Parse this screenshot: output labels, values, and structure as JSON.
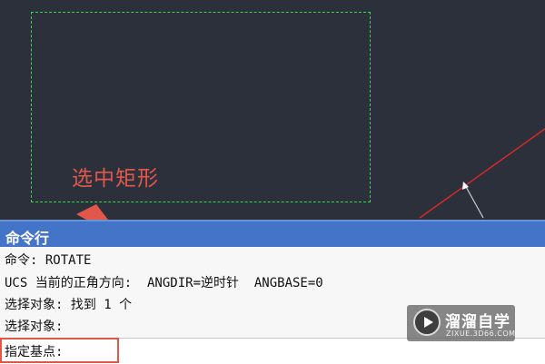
{
  "canvas": {
    "annotation": "选中矩形",
    "colors": {
      "background": "#2c303b",
      "selection": "#38d64a",
      "annotation": "#e2574c",
      "line": "#d8292c"
    }
  },
  "command_window": {
    "title": "命令行",
    "history": [
      "命令: ROTATE",
      "UCS 当前的正角方向:  ANGDIR=逆时针  ANGBASE=0",
      "选择对象: 找到 1 个",
      "选择对象:"
    ],
    "prompt": "指定基点:",
    "colors": {
      "titlebar": "#4374c7"
    }
  },
  "watermark": {
    "name": "溜溜自学",
    "url": "ZIXUE.3D66.COM"
  }
}
